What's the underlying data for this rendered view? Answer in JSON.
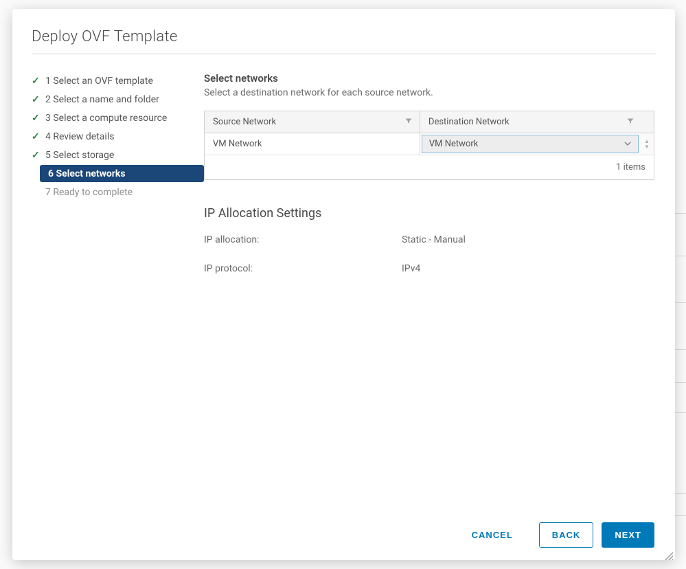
{
  "modal": {
    "title": "Deploy OVF Template"
  },
  "wizard": {
    "steps": [
      {
        "id": 1,
        "label": "1 Select an OVF template",
        "state": "completed"
      },
      {
        "id": 2,
        "label": "2 Select a name and folder",
        "state": "completed"
      },
      {
        "id": 3,
        "label": "3 Select a compute resource",
        "state": "completed"
      },
      {
        "id": 4,
        "label": "4 Review details",
        "state": "completed"
      },
      {
        "id": 5,
        "label": "5 Select storage",
        "state": "completed"
      },
      {
        "id": 6,
        "label": "6 Select networks",
        "state": "current"
      },
      {
        "id": 7,
        "label": "7 Ready to complete",
        "state": "pending"
      }
    ]
  },
  "content": {
    "title": "Select networks",
    "subtitle": "Select a destination network for each source network.",
    "table": {
      "headers": {
        "source": "Source Network",
        "destination": "Destination Network"
      },
      "rows": [
        {
          "source": "VM Network",
          "destination": "VM Network"
        }
      ],
      "footer": "1 items"
    },
    "ip_section": {
      "title": "IP Allocation Settings",
      "allocation_label": "IP allocation:",
      "allocation_value": "Static - Manual",
      "protocol_label": "IP protocol:",
      "protocol_value": "IPv4"
    }
  },
  "footer": {
    "cancel": "CANCEL",
    "back": "BACK",
    "next": "NEXT"
  }
}
